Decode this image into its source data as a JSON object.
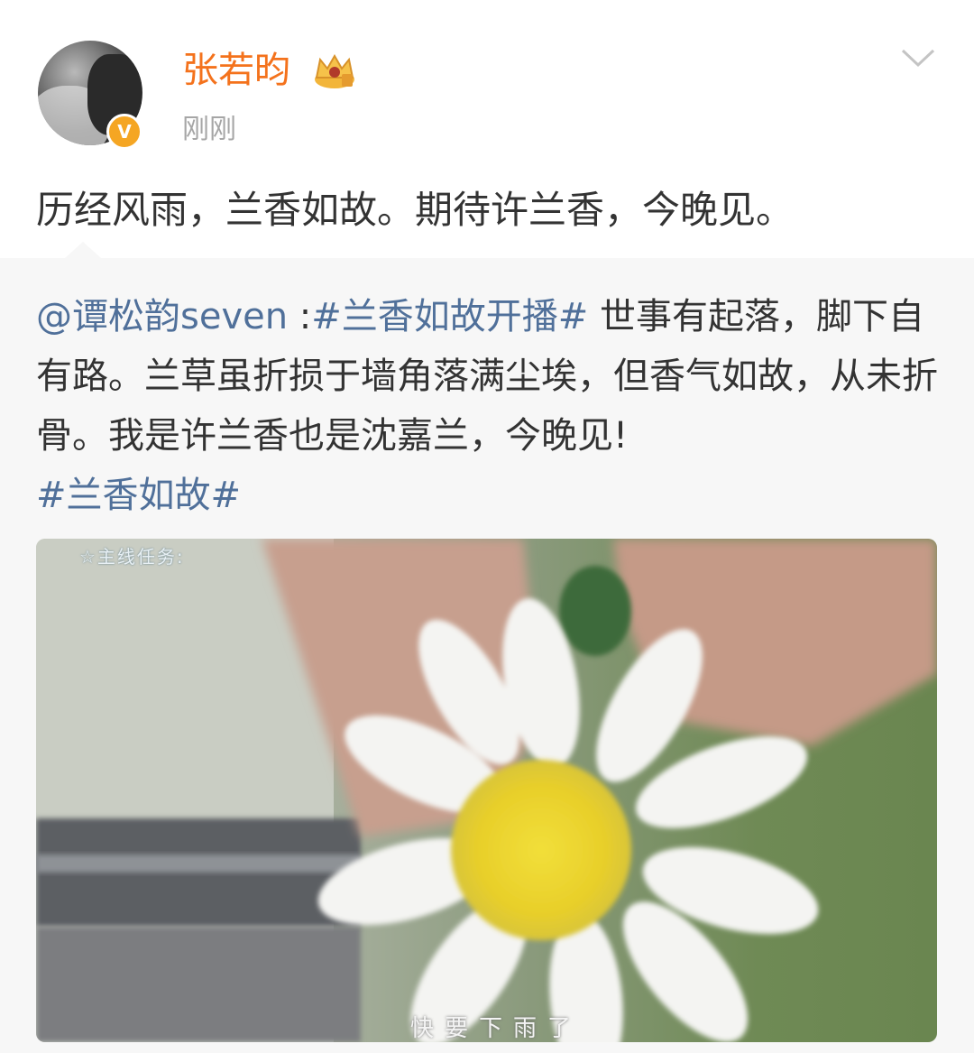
{
  "post": {
    "username": "张若昀",
    "timestamp": "刚刚",
    "text": "历经风雨，兰香如故。期待许兰香，今晚见。",
    "verified_badge": "V",
    "icons": {
      "avatar": "user-avatar",
      "crown": "crown-icon",
      "menu": "chevron-down-icon"
    }
  },
  "repost": {
    "mention": "@谭松韵seven",
    "separator": " :",
    "hashtag_1": "#兰香如故开播#",
    "body": " 世事有起落，脚下自有路。兰草虽折损于墙角落满尘埃，但香气如故，从未折骨。我是许兰香也是沈嘉兰，今晚见!",
    "hashtag_2": "#兰香如故#"
  },
  "media": {
    "caption_top": "☆主线任务:",
    "caption_bottom": "快要下雨了"
  },
  "colors": {
    "username": "#f4721c",
    "link": "#50709a",
    "timestamp": "#a6a6a6",
    "repost_bg": "#f7f7f7",
    "badge": "#f5a623"
  }
}
